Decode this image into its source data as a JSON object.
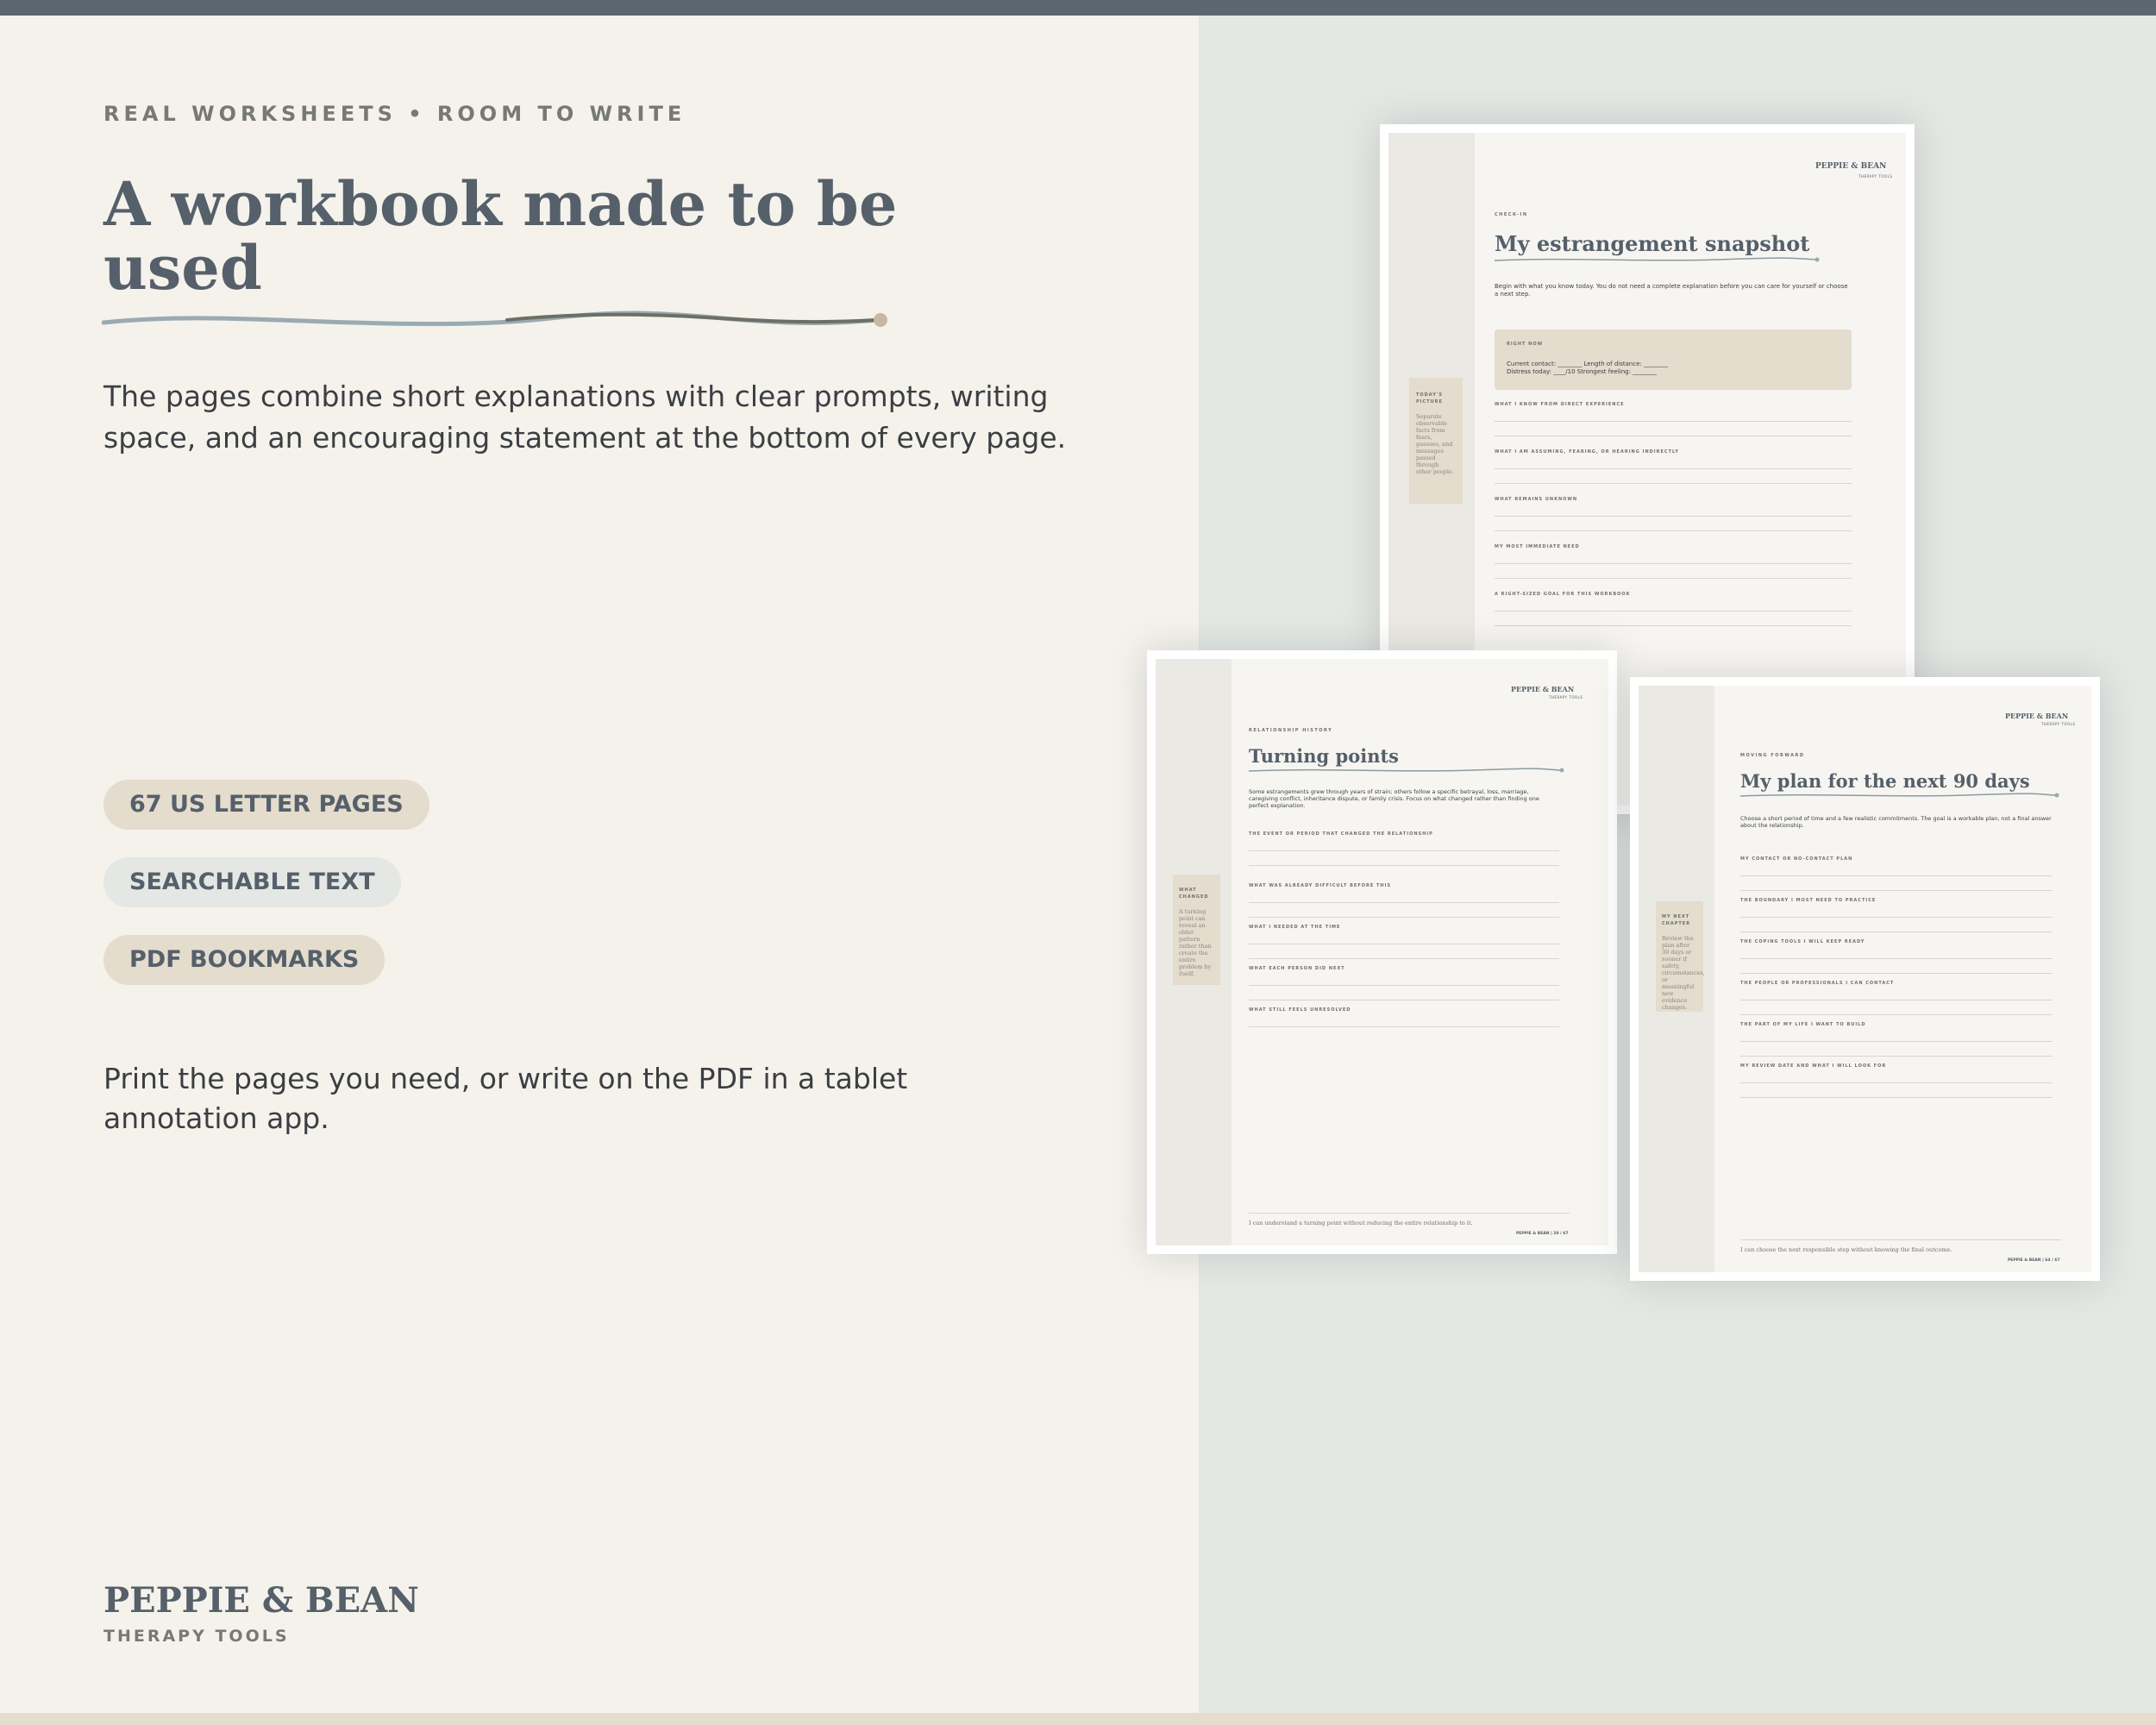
{
  "hero": {
    "eyebrow": "REAL WORKSHEETS • ROOM TO WRITE",
    "headline_line1": "A workbook made to be",
    "headline_line2": "used",
    "lead": "The pages combine short explanations with clear prompts, writing space, and an encouraging statement at the bottom of every page.",
    "features": [
      "67 US LETTER PAGES",
      "SEARCHABLE TEXT",
      "PDF BOOKMARKS"
    ],
    "note": "Print the pages you need, or write on the PDF in a tablet annotation app."
  },
  "brand": {
    "name": "PEPPIE & BEAN",
    "tagline": "THERAPY TOOLS"
  },
  "colors": {
    "slate": "#55606a",
    "top_bar": "#5b6670",
    "cream": "#f5f2ec",
    "sand": "#e4dccd",
    "mist": "#e4e7e3",
    "underline_blue": "#9aaab2",
    "underline_dark": "#6c7064",
    "underline_dot": "#c8b8a0"
  },
  "pages": [
    {
      "id": "snapshot",
      "brand": "PEPPIE & BEAN",
      "brand_sub": "THERAPY TOOLS",
      "eyebrow": "CHECK-IN",
      "title": "My estrangement snapshot",
      "intro": "Begin with what you know today. You do not need a complete explanation before you can care for yourself or choose a next step.",
      "box_title": "RIGHT NOW",
      "box_line1": "Current contact: ________  Length of distance: ________",
      "box_line2": "Distress today: ____/10  Strongest feeling: ________",
      "sidebar_title": "TODAY'S PICTURE",
      "sidebar_text": "Separate observable facts from fears, guesses, and messages passed through other people.",
      "prompts": [
        "WHAT I KNOW FROM DIRECT EXPERIENCE",
        "WHAT I AM ASSUMING, FEARING, OR HEARING INDIRECTLY",
        "WHAT REMAINS UNKNOWN",
        "MY MOST IMMEDIATE NEED",
        "A RIGHT-SIZED GOAL FOR THIS WORKBOOK"
      ]
    },
    {
      "id": "turning",
      "brand": "PEPPIE & BEAN",
      "brand_sub": "THERAPY TOOLS",
      "eyebrow": "RELATIONSHIP HISTORY",
      "title": "Turning points",
      "intro": "Some estrangements grew through years of strain; others follow a specific betrayal, loss, marriage, caregiving conflict, inheritance dispute, or family crisis. Focus on what changed rather than finding one perfect explanation.",
      "sidebar_title": "WHAT CHANGED",
      "sidebar_text": "A turning point can reveal an older pattern rather than create the entire problem by itself.",
      "prompts": [
        "THE EVENT OR PERIOD THAT CHANGED THE RELATIONSHIP",
        "WHAT WAS ALREADY DIFFICULT BEFORE THIS",
        "WHAT I NEEDED AT THE TIME",
        "WHAT EACH PERSON DID NEXT",
        "WHAT STILL FEELS UNRESOLVED"
      ],
      "footer": "I can understand a turning point without reducing the entire relationship to it.",
      "page_num": "PEPPIE & BEAN | 20 / 67"
    },
    {
      "id": "plan",
      "brand": "PEPPIE & BEAN",
      "brand_sub": "THERAPY TOOLS",
      "eyebrow": "MOVING FORWARD",
      "title": "My plan for the next 90 days",
      "intro": "Choose a short period of time and a few realistic commitments. The goal is a workable plan, not a final answer about the relationship.",
      "sidebar_title": "MY NEXT CHAPTER",
      "sidebar_text": "Review the plan after 30 days or sooner if safety, circumstances, or meaningful new evidence changes.",
      "prompts": [
        "MY CONTACT OR NO-CONTACT PLAN",
        "THE BOUNDARY I MOST NEED TO PRACTICE",
        "THE COPING TOOLS I WILL KEEP READY",
        "THE PEOPLE OR PROFESSIONALS I CAN CONTACT",
        "THE PART OF MY LIFE I WANT TO BUILD",
        "MY REVIEW DATE AND WHAT I WILL LOOK FOR"
      ],
      "footer": "I can choose the next responsible step without knowing the final outcome.",
      "page_num": "PEPPIE & BEAN | 64 / 67"
    }
  ]
}
